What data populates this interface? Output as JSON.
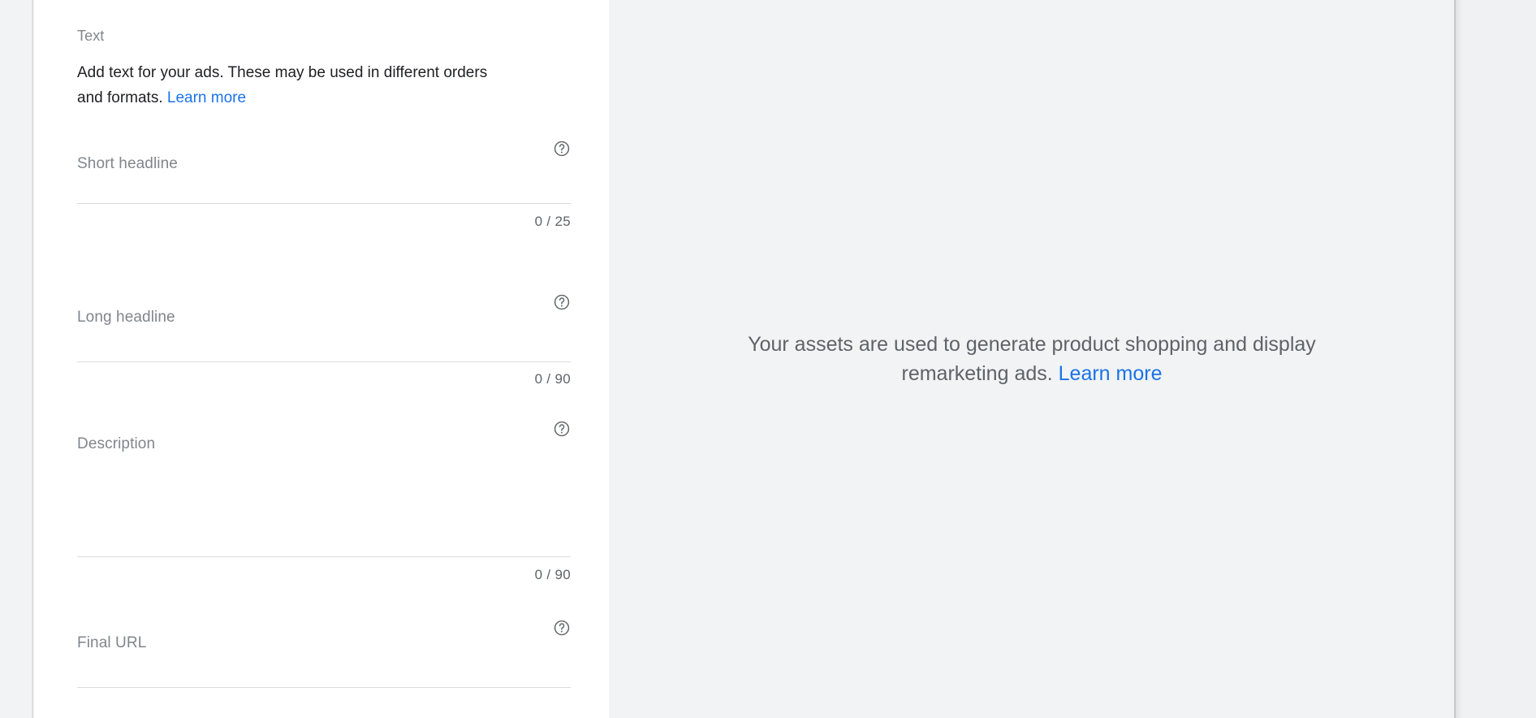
{
  "panel": {
    "section_label": "Text",
    "section_description_part1": "Add text for your ads. These may be used in different orders and formats. ",
    "section_description_link": "Learn more",
    "help_icon_name": "help-icon"
  },
  "fields": [
    {
      "id": "short-headline",
      "label": "Short headline",
      "value": "",
      "placeholder": "",
      "counter": "0 / 25",
      "max": 25,
      "type": "input"
    },
    {
      "id": "long-headline",
      "label": "Long headline",
      "value": "",
      "placeholder": "",
      "counter": "0 / 90",
      "max": 90,
      "type": "input"
    },
    {
      "id": "description",
      "label": "Description",
      "value": "",
      "placeholder": "",
      "counter": "0 / 90",
      "max": 90,
      "type": "textarea"
    },
    {
      "id": "final-url",
      "label": "Final URL",
      "value": "",
      "placeholder": "",
      "counter": "",
      "type": "input"
    }
  ],
  "preview": {
    "message_part1": "Your assets are used to generate product shopping and display remarketing ads. ",
    "message_link": "Learn more"
  },
  "colors": {
    "link_blue": "#1a73e8",
    "label_gray": "#80868b",
    "body_text": "#202124",
    "muted_text": "#5f6368",
    "panel_bg": "#f1f3f4",
    "underline": "#dadce0",
    "white": "#ffffff"
  }
}
